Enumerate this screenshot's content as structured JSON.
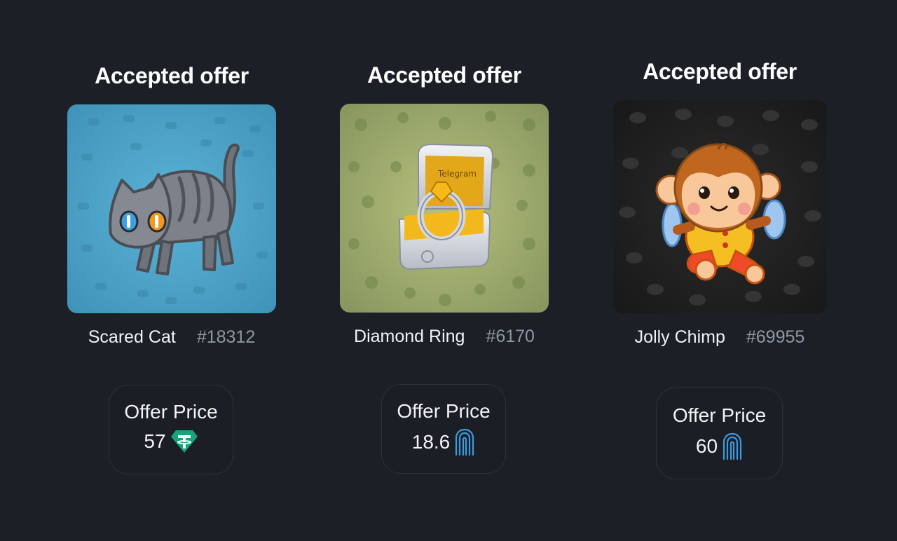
{
  "cards": [
    {
      "title": "Accepted offer",
      "gift_name": "Scared Cat",
      "gift_number": "#18312",
      "price_label": "Offer Price",
      "price_value": "57",
      "currency_icon": "usdt-icon",
      "background": "#4aa2c6"
    },
    {
      "title": "Accepted offer",
      "gift_name": "Diamond Ring",
      "gift_number": "#6170",
      "price_label": "Offer Price",
      "price_value": "18.6",
      "currency_icon": "fingerprint-icon",
      "background": "#8fa067",
      "box_brand": "Telegram"
    },
    {
      "title": "Accepted offer",
      "gift_name": "Jolly Chimp",
      "gift_number": "#69955",
      "price_label": "Offer Price",
      "price_value": "60",
      "currency_icon": "fingerprint-icon",
      "background": "#232323"
    }
  ],
  "colors": {
    "page_background": "#1c1f26",
    "number_text": "#8e97a6",
    "usdt_teal": "#1ba27a",
    "fingerprint_blue": "#3b9be0"
  }
}
